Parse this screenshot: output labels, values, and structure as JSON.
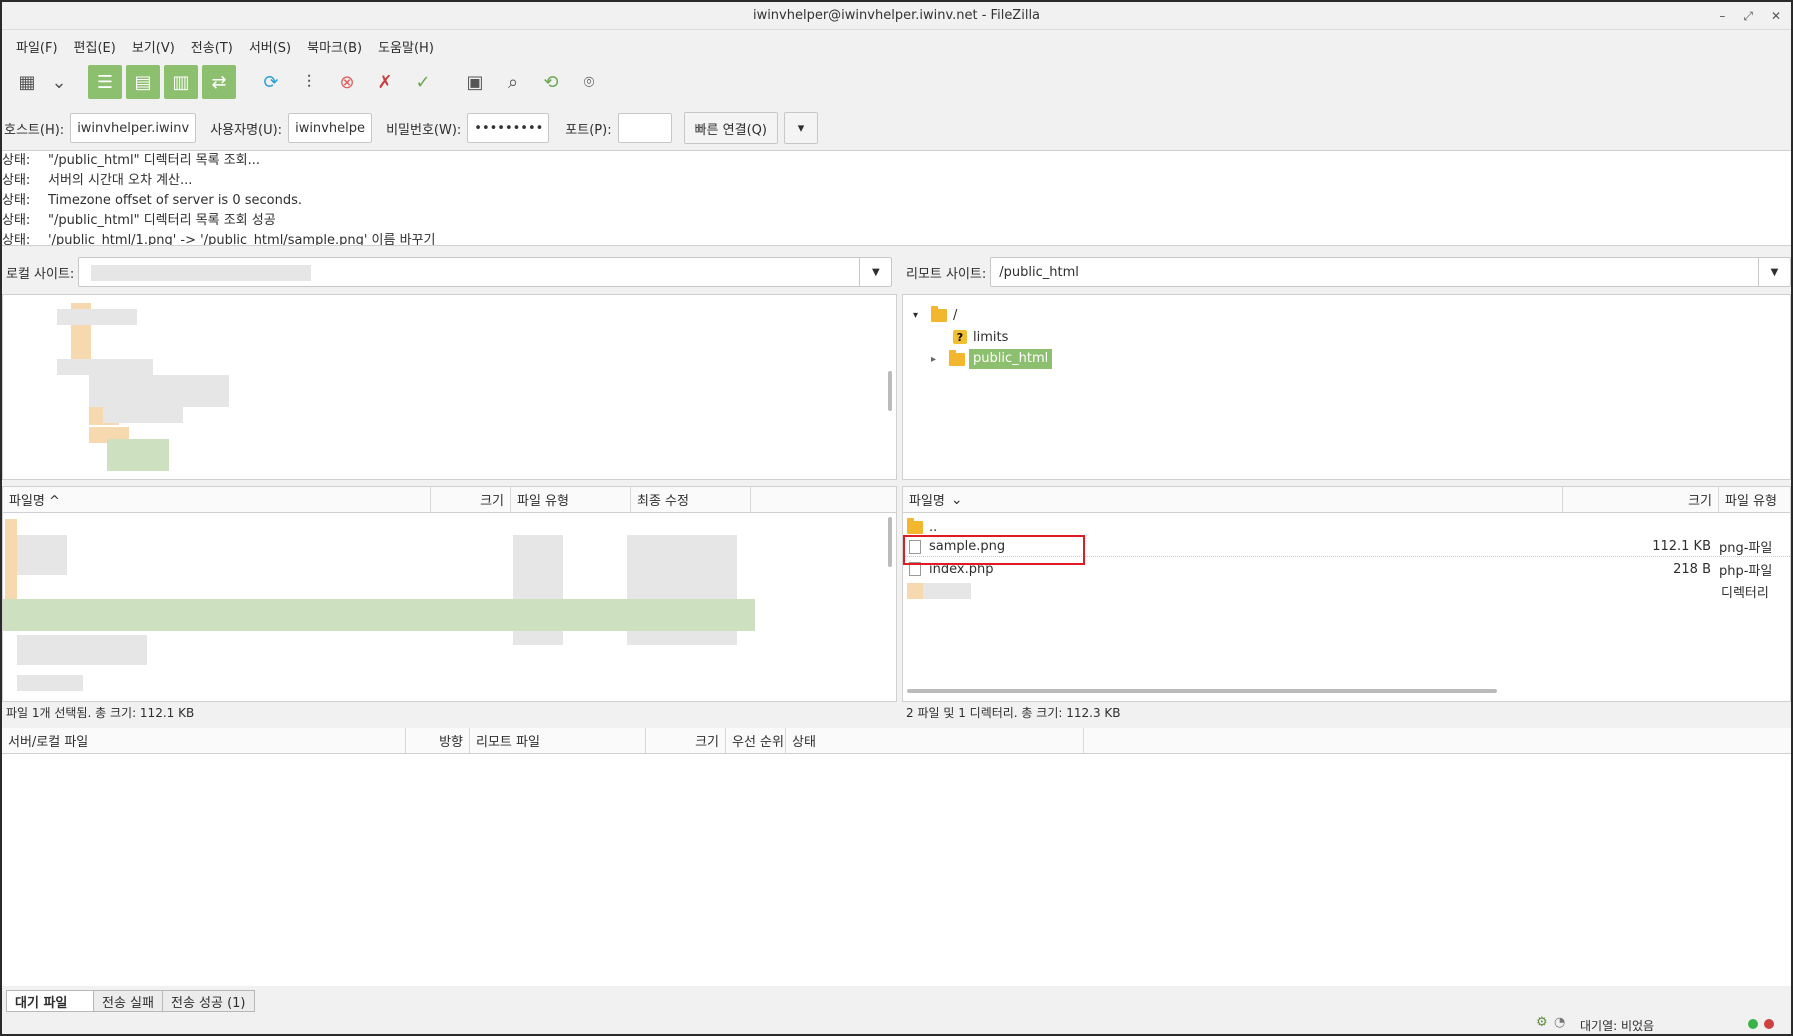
{
  "window": {
    "title": "iwinvhelper@iwinvhelper.iwinv.net - FileZilla",
    "controls": {
      "minimize": "–",
      "restore": "⤢",
      "close": "✕"
    }
  },
  "menu": [
    "파일(F)",
    "편집(E)",
    "보기(V)",
    "전송(T)",
    "서버(S)",
    "북마크(B)",
    "도움말(H)"
  ],
  "toolbar": {
    "items": [
      {
        "icon": "site-manager-icon",
        "glyph": "▦"
      },
      {
        "icon": "chevron-down-icon",
        "glyph": "⌄"
      },
      {
        "icon": "message-log-icon",
        "glyph": "☰"
      },
      {
        "icon": "local-tree-icon",
        "glyph": "▤"
      },
      {
        "icon": "remote-tree-icon",
        "glyph": "▥"
      },
      {
        "icon": "transfer-queue-icon",
        "glyph": "⇄"
      },
      {
        "icon": "refresh-icon",
        "glyph": "⟳"
      },
      {
        "icon": "process-queue-icon",
        "glyph": "⫶"
      },
      {
        "icon": "cancel-icon",
        "glyph": "⊗"
      },
      {
        "icon": "disconnect-icon",
        "glyph": "✗"
      },
      {
        "icon": "reconnect-icon",
        "glyph": "✓"
      },
      {
        "icon": "directory-listing-filter-icon",
        "glyph": "▣"
      },
      {
        "icon": "sync-browsing-icon",
        "glyph": "⌕"
      },
      {
        "icon": "directory-compare-icon",
        "glyph": "⟲"
      },
      {
        "icon": "search-files-icon",
        "glyph": "⌾"
      }
    ],
    "colors": {
      "toggle_on": "#8cbf6e",
      "refresh": "#2a9fd6",
      "cancel": "#e05d5d"
    }
  },
  "quickconnect": {
    "host_label": "호스트(H):",
    "host_value": "iwinvhelper.iwinv.r",
    "user_label": "사용자명(U):",
    "user_value": "iwinvhelpe",
    "pass_label": "비밀번호(W):",
    "pass_value": "••••••••••",
    "port_label": "포트(P):",
    "port_value": "",
    "connect_label": "빠른 연결(Q)",
    "dropdown": "▾"
  },
  "log": [
    {
      "k": "상태:",
      "v": "\"/public_html\" 디렉터리 목록 조회..."
    },
    {
      "k": "상태:",
      "v": "서버의 시간대 오차 계산..."
    },
    {
      "k": "상태:",
      "v": "Timezone offset of server is 0 seconds."
    },
    {
      "k": "상태:",
      "v": "\"/public_html\" 디렉터리 목록 조회 성공"
    },
    {
      "k": "상태:",
      "v": "'/public_html/1.png' -> '/public_html/sample.png' 이름 바꾸기"
    }
  ],
  "local": {
    "site_label": "로컬 사이트:",
    "site_value": "",
    "columns": [
      "파일명 ^",
      "크기",
      "파일 유형",
      "최종 수정"
    ],
    "status": "파일 1개 선택됨. 총 크기: 112.1 KB"
  },
  "remote": {
    "site_label": "리모트 사이트:",
    "site_value": "/public_html",
    "tree": [
      {
        "label": "/",
        "expander": "▾"
      },
      {
        "label": "limits"
      },
      {
        "label": "public_html",
        "expander": "▸"
      }
    ],
    "columns": [
      "파일명",
      "크기",
      "파일 유형"
    ],
    "sort_glyph": "⌄",
    "files": [
      {
        "name": "..",
        "size": "",
        "type": ""
      },
      {
        "name": "sample.png",
        "size": "112.1 KB",
        "type": "png-파일"
      },
      {
        "name": "index.php",
        "size": "218 B",
        "type": "php-파일"
      },
      {
        "name": "",
        "size": "",
        "type": "디렉터리"
      }
    ],
    "status": "2 파일 및 1 디렉터리. 총 크기: 112.3 KB",
    "highlight_color": "#e01b24"
  },
  "queue": {
    "columns": [
      "서버/로컬 파일",
      "방향",
      "리모트 파일",
      "크기",
      "우선 순위",
      "상태"
    ],
    "tabs": [
      "대기 파일",
      "전송 실패",
      "전송 성공 (1)"
    ],
    "status": "대기열: 비었음"
  }
}
